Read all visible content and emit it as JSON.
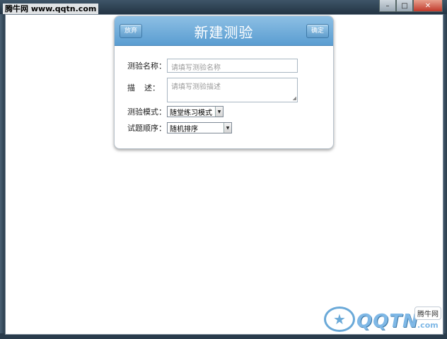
{
  "watermark_top": "腾牛网 www.qqtn.com",
  "window_controls": {
    "minimize": "–",
    "maximize": "□",
    "close": "✕"
  },
  "dialog": {
    "title": "新建测验",
    "discard_label": "放弃",
    "confirm_label": "确定",
    "name_label": "测验名称：",
    "name_placeholder": "请填写测验名称",
    "desc_label_a": "描",
    "desc_label_b": "述：",
    "desc_placeholder": "请填写测验描述",
    "mode_label": "测验模式：",
    "mode_value": "随堂练习模式",
    "order_label": "试题顺序：",
    "order_value": "随机排序"
  },
  "watermark_br": {
    "brand": "QQTN",
    "suffix": ".com",
    "cn": "腾牛网"
  }
}
